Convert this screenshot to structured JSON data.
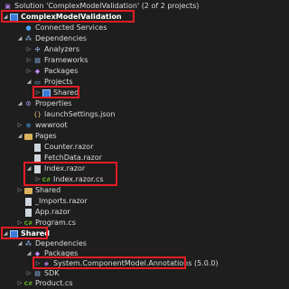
{
  "solution": {
    "label": "Solution 'ComplexModelValidation' (2 of 2 projects)"
  },
  "tree": [
    {
      "id": "proj1",
      "label": "ComplexModelValidation"
    },
    {
      "id": "connected",
      "label": "Connected Services"
    },
    {
      "id": "deps1",
      "label": "Dependencies"
    },
    {
      "id": "analyzers",
      "label": "Analyzers"
    },
    {
      "id": "frameworks",
      "label": "Frameworks"
    },
    {
      "id": "packages1",
      "label": "Packages"
    },
    {
      "id": "projects",
      "label": "Projects"
    },
    {
      "id": "shared_ref",
      "label": "Shared"
    },
    {
      "id": "properties",
      "label": "Properties"
    },
    {
      "id": "launch",
      "label": "launchSettings.json"
    },
    {
      "id": "wwwroot",
      "label": "wwwroot"
    },
    {
      "id": "pages",
      "label": "Pages"
    },
    {
      "id": "counter",
      "label": "Counter.razor"
    },
    {
      "id": "fetch",
      "label": "FetchData.razor"
    },
    {
      "id": "index",
      "label": "Index.razor"
    },
    {
      "id": "indexcs",
      "label": "Index.razor.cs"
    },
    {
      "id": "sharedfolder",
      "label": "Shared"
    },
    {
      "id": "imports",
      "label": "_Imports.razor"
    },
    {
      "id": "app",
      "label": "App.razor"
    },
    {
      "id": "program",
      "label": "Program.cs"
    },
    {
      "id": "proj2",
      "label": "Shared"
    },
    {
      "id": "deps2",
      "label": "Dependencies"
    },
    {
      "id": "packages2",
      "label": "Packages"
    },
    {
      "id": "annot",
      "label": "System.ComponentModel.Annotations (5.0.0)"
    },
    {
      "id": "sdk",
      "label": "SDK"
    },
    {
      "id": "product",
      "label": "Product.cs"
    }
  ]
}
